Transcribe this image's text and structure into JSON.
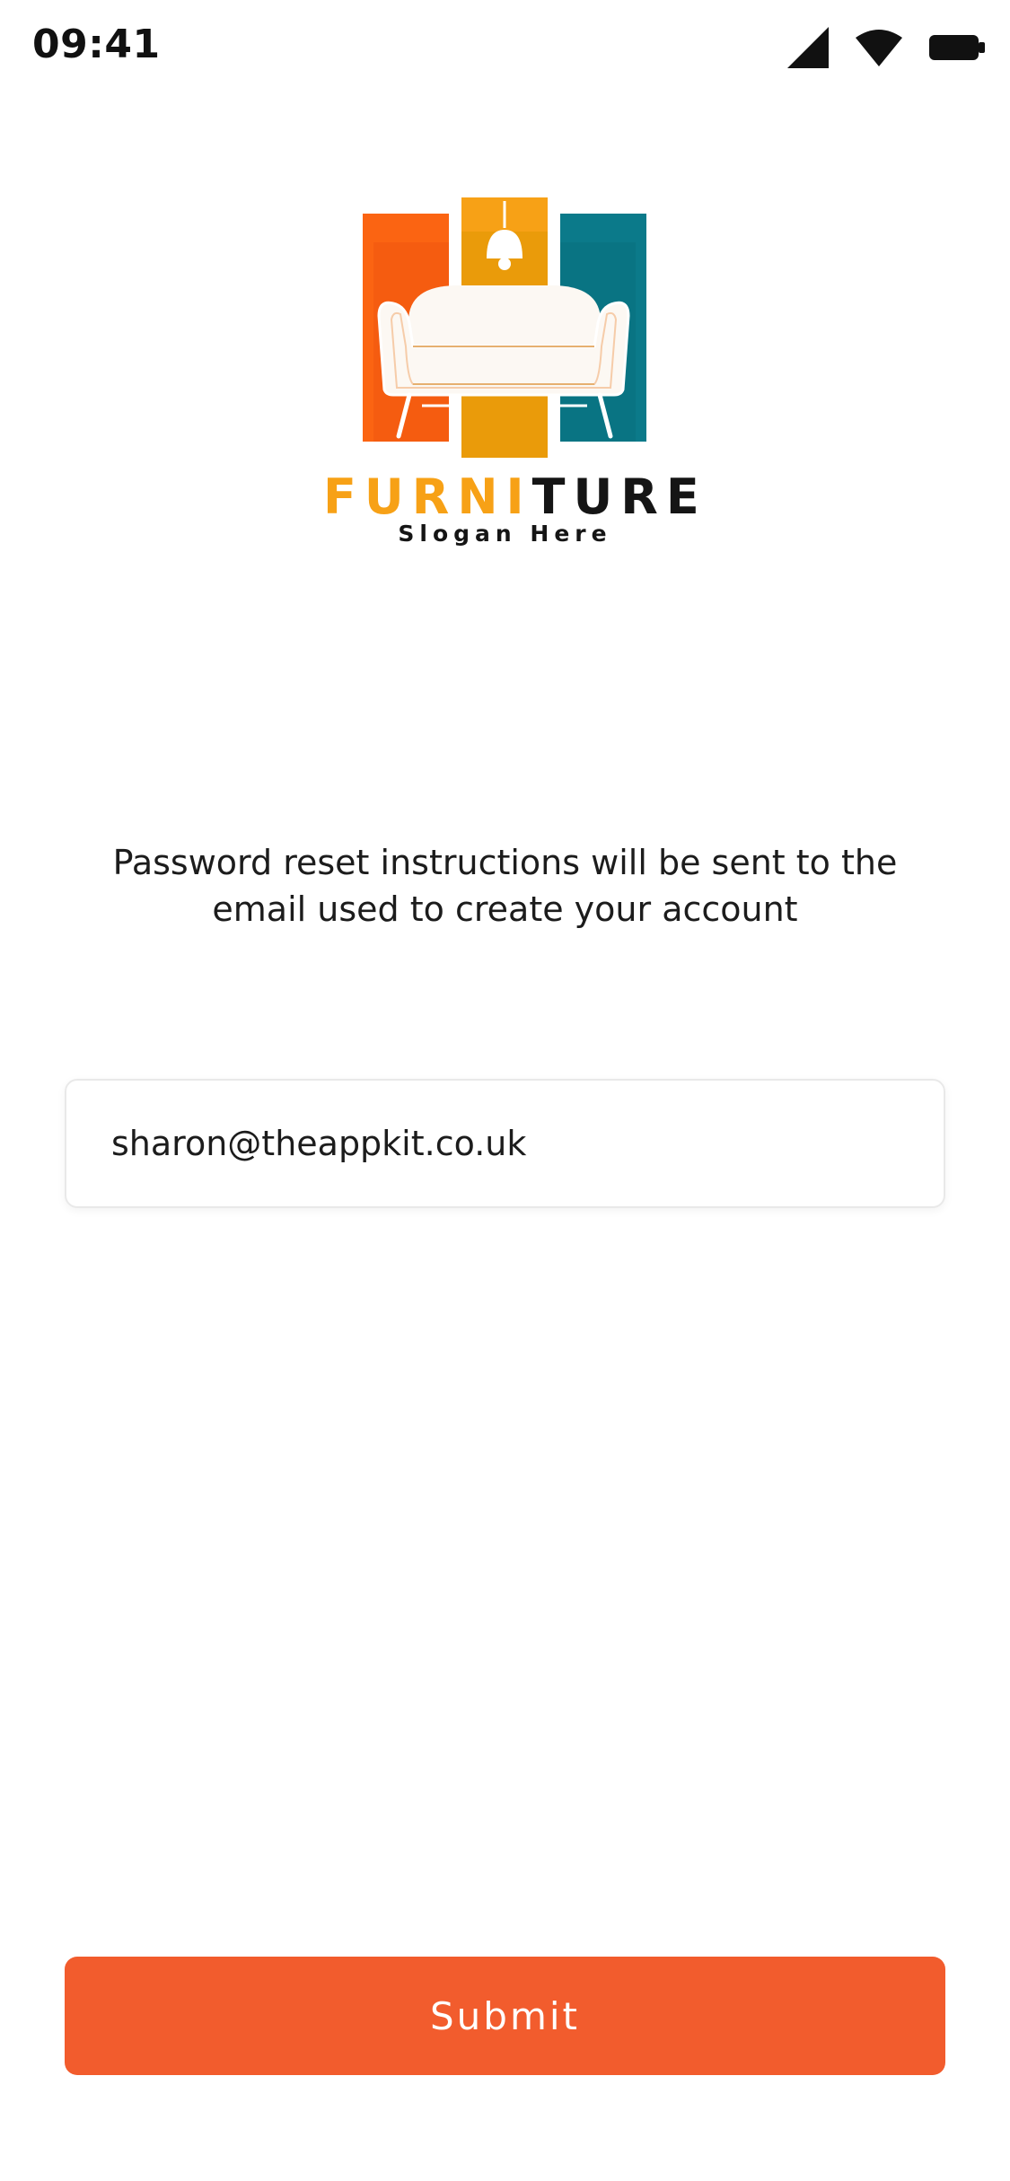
{
  "status_bar": {
    "time": "09:41",
    "icons": [
      "cellular-signal-icon",
      "wifi-icon",
      "battery-icon"
    ]
  },
  "logo": {
    "word_part1": "FURNI",
    "word_part2": "TURE",
    "slogan": "Slogan Here",
    "colors": {
      "orange": "#f95e12",
      "yellow": "#f7a116",
      "teal": "#0b7a8a",
      "dark": "#151515"
    }
  },
  "reset": {
    "instructions_line1": "Password reset instructions will be sent to the",
    "instructions_line2": "email used to create your account",
    "email_value": "sharon@theappkit.co.uk",
    "submit_label": "Submit"
  },
  "theme": {
    "accent": "#f25c2d",
    "background": "#ffffff",
    "text": "#1c1c1c"
  }
}
